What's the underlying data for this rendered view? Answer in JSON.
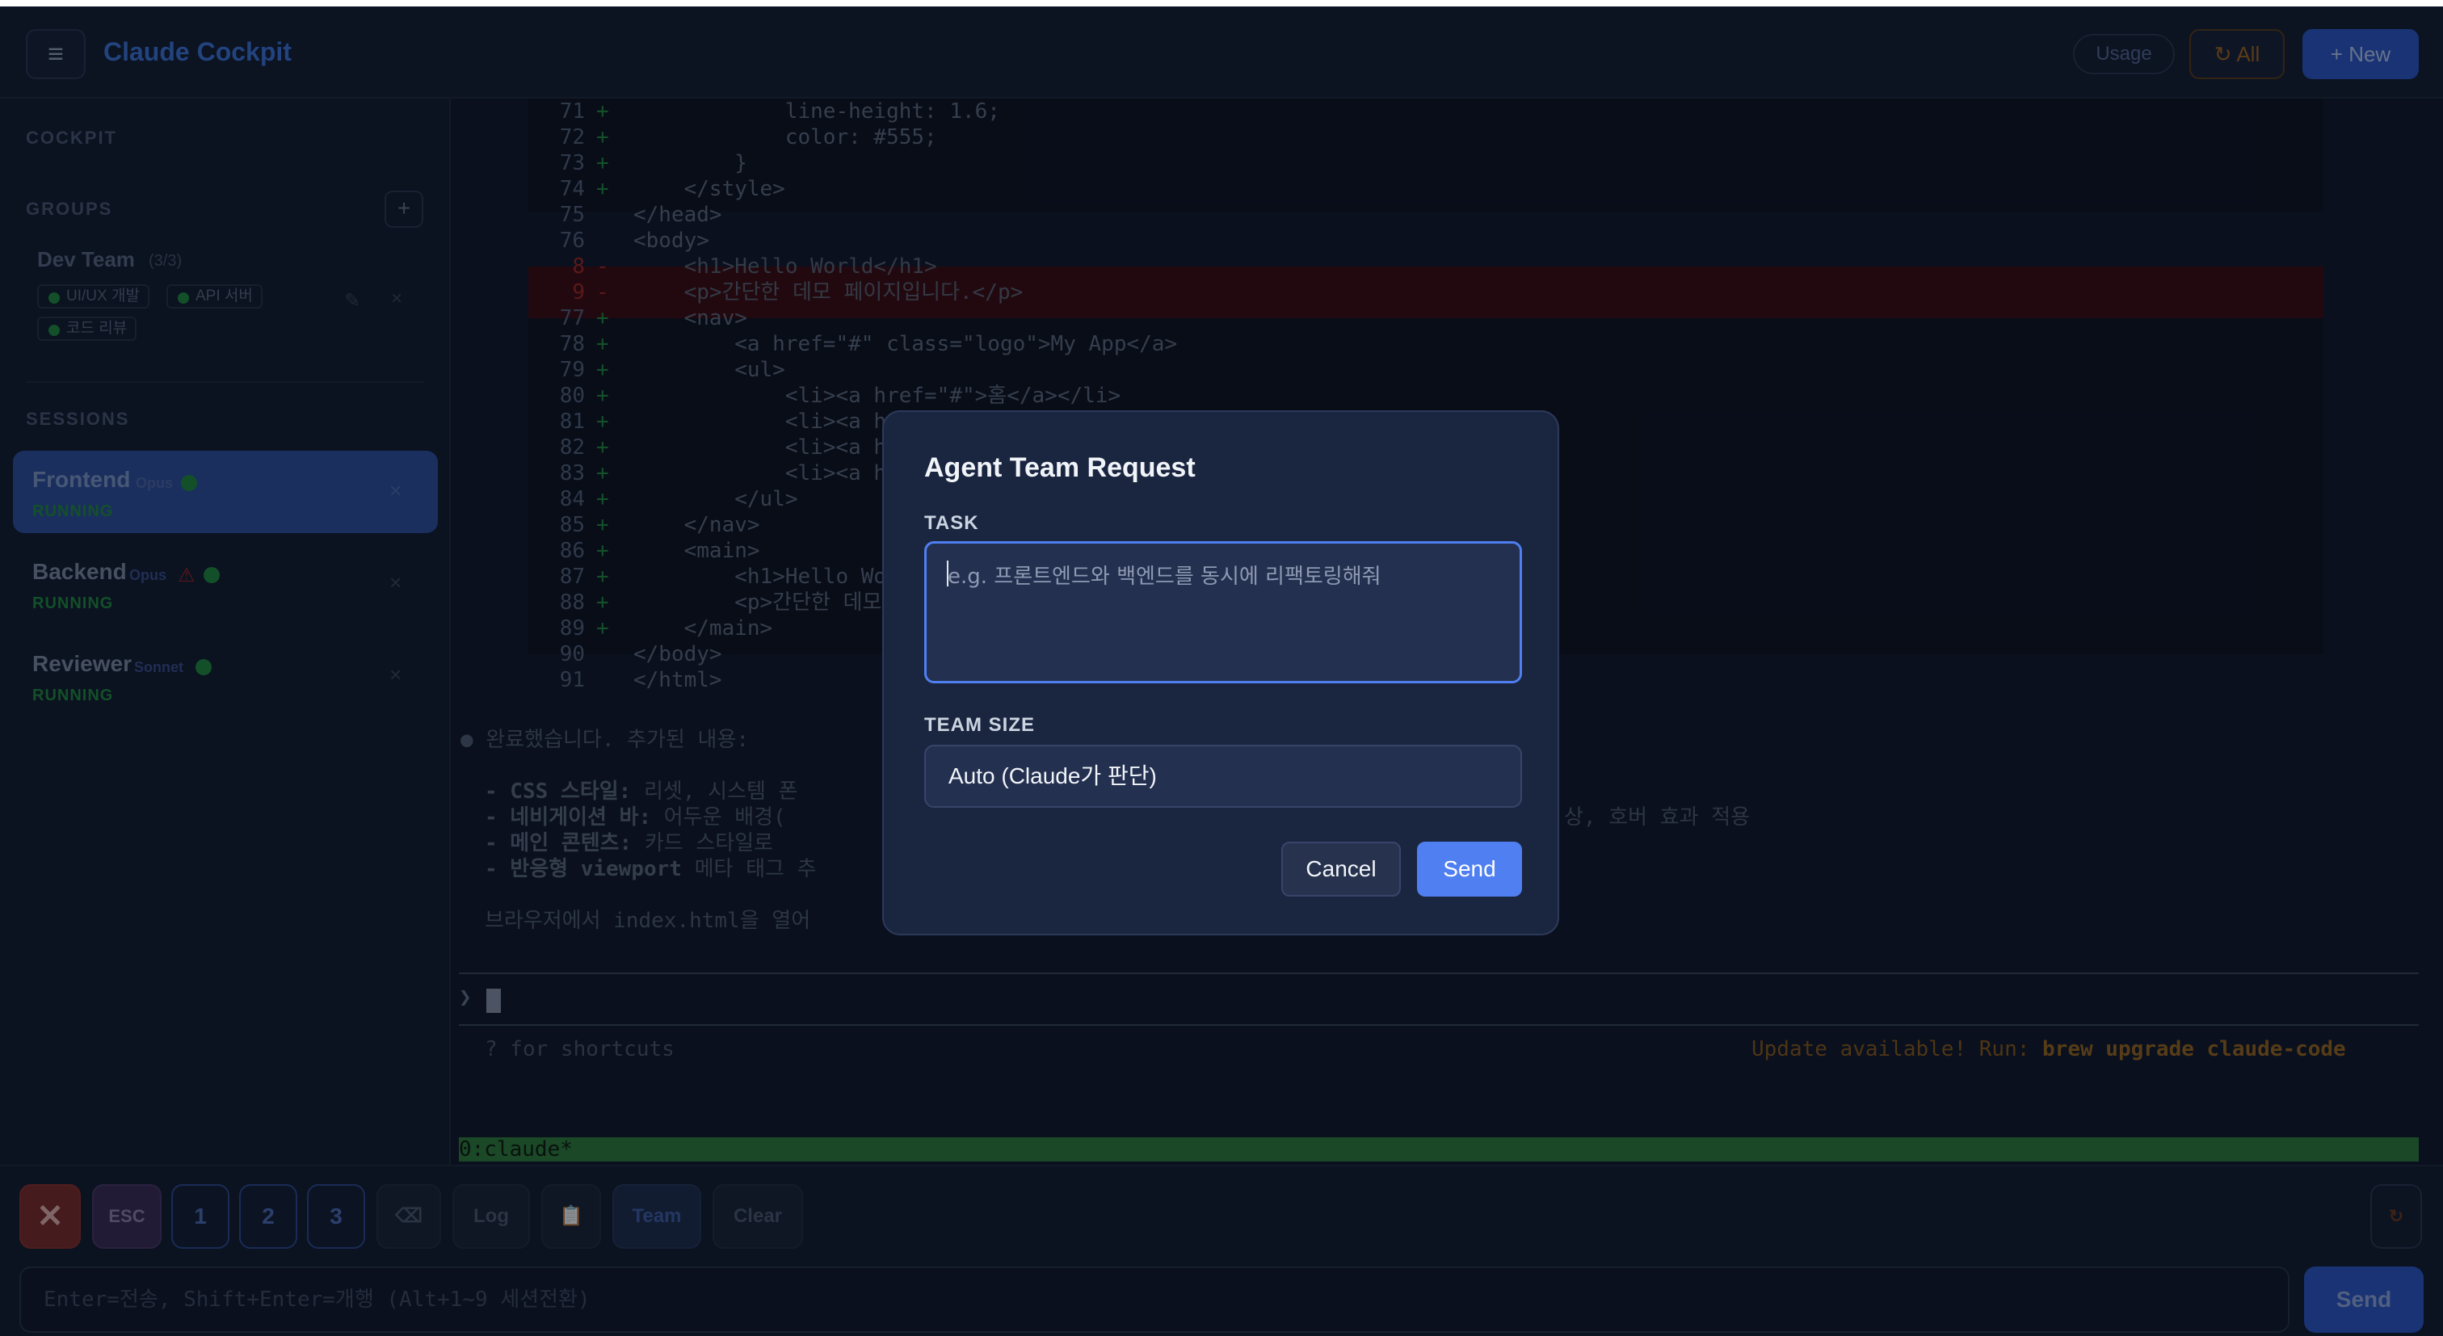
{
  "header": {
    "menu_icon": "≡",
    "title": "Claude Cockpit",
    "usage_label": "Usage",
    "all_label": "↻ All",
    "new_label": "+ New"
  },
  "sidebar": {
    "cockpit_label": "COCKPIT",
    "groups_label": "GROUPS",
    "add_group": "+",
    "group": {
      "name": "Dev Team",
      "count": "(3/3)",
      "chips": [
        "UI/UX 개발",
        "API 서버",
        "코드 리뷰"
      ],
      "edit_icon": "✎",
      "close_icon": "×"
    },
    "sessions_label": "SESSIONS",
    "sessions": [
      {
        "name": "Frontend",
        "model": "Opus",
        "status": "RUNNING",
        "warning": "",
        "close": "×"
      },
      {
        "name": "Backend",
        "model": "Opus",
        "status": "RUNNING",
        "warning": "⚠",
        "close": "×"
      },
      {
        "name": "Reviewer",
        "model": "Sonnet",
        "status": "RUNNING",
        "warning": "",
        "close": "×"
      }
    ]
  },
  "terminal": {
    "code_lines": [
      {
        "ln": "71",
        "mk": "+",
        "text": "            line-height: 1.6;",
        "type": "add"
      },
      {
        "ln": "72",
        "mk": "+",
        "text": "            color: #555;",
        "type": "add"
      },
      {
        "ln": "73",
        "mk": "+",
        "text": "        }",
        "type": "add"
      },
      {
        "ln": "74",
        "mk": "+",
        "text": "    </style>",
        "type": "add"
      },
      {
        "ln": "75",
        "mk": "",
        "text": "</head>",
        "type": "ctx"
      },
      {
        "ln": "76",
        "mk": "",
        "text": "<body>",
        "type": "ctx"
      },
      {
        "ln": "8",
        "mk": "-",
        "text": "    <h1>Hello World</h1>",
        "type": "del"
      },
      {
        "ln": "9",
        "mk": "-",
        "text": "    <p>간단한 데모 페이지입니다.</p>",
        "type": "del"
      },
      {
        "ln": "77",
        "mk": "+",
        "text": "    <nav>",
        "type": "add"
      },
      {
        "ln": "78",
        "mk": "+",
        "text": "        <a href=\"#\" class=\"logo\">My App</a>",
        "type": "add"
      },
      {
        "ln": "79",
        "mk": "+",
        "text": "        <ul>",
        "type": "add"
      },
      {
        "ln": "80",
        "mk": "+",
        "text": "            <li><a href=\"#\">홈</a></li>",
        "type": "add"
      },
      {
        "ln": "81",
        "mk": "+",
        "text": "            <li><a hr",
        "type": "add"
      },
      {
        "ln": "82",
        "mk": "+",
        "text": "            <li><a hr",
        "type": "add"
      },
      {
        "ln": "83",
        "mk": "+",
        "text": "            <li><a hr",
        "type": "add"
      },
      {
        "ln": "84",
        "mk": "+",
        "text": "        </ul>",
        "type": "add"
      },
      {
        "ln": "85",
        "mk": "+",
        "text": "    </nav>",
        "type": "add"
      },
      {
        "ln": "86",
        "mk": "+",
        "text": "    <main>",
        "type": "add"
      },
      {
        "ln": "87",
        "mk": "+",
        "text": "        <h1>Hello Wor",
        "type": "add"
      },
      {
        "ln": "88",
        "mk": "+",
        "text": "        <p>간단한 데모",
        "type": "add"
      },
      {
        "ln": "89",
        "mk": "+",
        "text": "    </main>",
        "type": "add"
      },
      {
        "ln": "90",
        "mk": "",
        "text": "</body>",
        "type": "ctx"
      },
      {
        "ln": "91",
        "mk": "",
        "text": "</html>",
        "type": "ctx"
      }
    ],
    "summary_head": "● 완료했습니다. 추가된 내용:",
    "bullets": [
      {
        "bold": "- CSS 스타일:",
        "rest": " 리셋, 시스템 폰"
      },
      {
        "bold": "- 네비게이션 바:",
        "rest": " 어두운 배경(",
        "tail": "상, 호버 효과 적용"
      },
      {
        "bold": "- 메인 콘텐츠:",
        "rest": " 카드 스타일로"
      },
      {
        "bold": "- 반응형 viewport",
        "rest": " 메타 태그 추"
      }
    ],
    "browser_line": "브라우저에서 index.html을 열어",
    "prompt": "❯",
    "shortcuts_hint": "? for shortcuts",
    "update_prefix": "Update available! Run: ",
    "update_cmd": "brew upgrade claude-code",
    "tmux_status": "0:claude*"
  },
  "toolbar": {
    "kill": "✕",
    "esc": "ESC",
    "nums": [
      "1",
      "2",
      "3"
    ],
    "backspace": "⌫",
    "log": "Log",
    "clipboard": "📋",
    "team": "Team",
    "clear": "Clear",
    "refresh": "↻",
    "input_placeholder": "Enter=전송, Shift+Enter=개행 (Alt+1~9 세션전환)",
    "send": "Send"
  },
  "modal": {
    "title": "Agent Team Request",
    "task_label": "TASK",
    "task_placeholder": "e.g. 프론트엔드와 백엔드를 동시에 리팩토링해줘",
    "team_size_label": "TEAM SIZE",
    "team_size_value": "Auto (Claude가 판단)",
    "cancel": "Cancel",
    "send": "Send"
  }
}
